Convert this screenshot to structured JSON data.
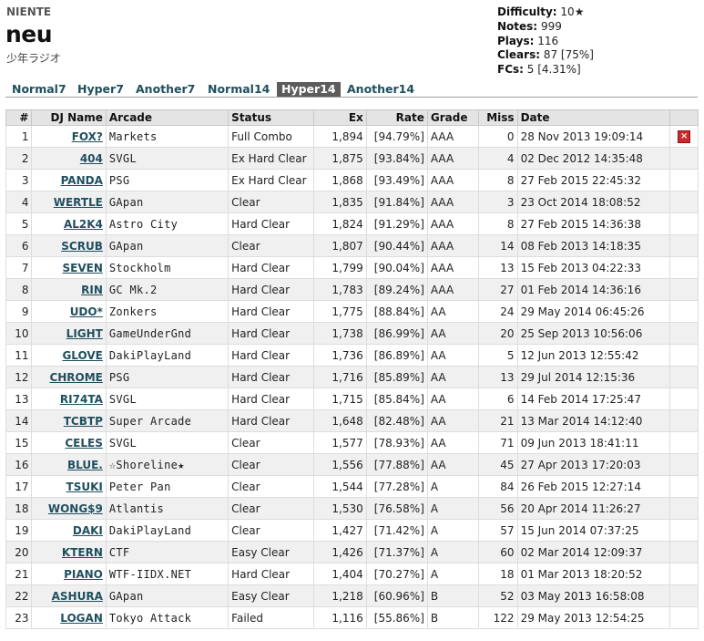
{
  "song": {
    "artist": "NIENTE",
    "title": "neu",
    "genre": "少年ラジオ"
  },
  "stats": [
    {
      "label": "Difficulty:",
      "value": "10★"
    },
    {
      "label": "Notes:",
      "value": "999"
    },
    {
      "label": "Plays:",
      "value": "116"
    },
    {
      "label": "Clears:",
      "value": "87 [75%]"
    },
    {
      "label": "FCs:",
      "value": "5 [4.31%]"
    }
  ],
  "tabs": [
    {
      "label": "Normal7"
    },
    {
      "label": "Hyper7"
    },
    {
      "label": "Another7"
    },
    {
      "label": "Normal14"
    },
    {
      "label": "Hyper14",
      "active": true
    },
    {
      "label": "Another14"
    }
  ],
  "table": {
    "headers": [
      "#",
      "DJ Name",
      "Arcade",
      "Status",
      "Ex",
      "Rate",
      "Grade",
      "Miss",
      "Date"
    ],
    "rows": [
      {
        "rank": "1",
        "dj": "FOX?",
        "arcade": "Markets",
        "status": "Full Combo",
        "ex": "1,894",
        "rate": "[94.79%]",
        "grade": "AAA",
        "miss": "0",
        "date": "28 Nov 2013 19:09:14",
        "delete": true
      },
      {
        "rank": "2",
        "dj": "404",
        "arcade": "SVGL",
        "status": "Ex Hard Clear",
        "ex": "1,875",
        "rate": "[93.84%]",
        "grade": "AAA",
        "miss": "4",
        "date": "02 Dec 2012 14:35:48"
      },
      {
        "rank": "3",
        "dj": "PANDA",
        "arcade": "PSG",
        "status": "Ex Hard Clear",
        "ex": "1,868",
        "rate": "[93.49%]",
        "grade": "AAA",
        "miss": "8",
        "date": "27 Feb 2015 22:45:32"
      },
      {
        "rank": "4",
        "dj": "WERTLE",
        "arcade": "GApan",
        "status": "Clear",
        "ex": "1,835",
        "rate": "[91.84%]",
        "grade": "AAA",
        "miss": "3",
        "date": "23 Oct 2014 18:08:52"
      },
      {
        "rank": "5",
        "dj": "AL2K4",
        "arcade": "Astro City",
        "status": "Hard Clear",
        "ex": "1,824",
        "rate": "[91.29%]",
        "grade": "AAA",
        "miss": "8",
        "date": "27 Feb 2015 14:36:38"
      },
      {
        "rank": "6",
        "dj": "SCRUB",
        "arcade": "GApan",
        "status": "Clear",
        "ex": "1,807",
        "rate": "[90.44%]",
        "grade": "AAA",
        "miss": "14",
        "date": "08 Feb 2013 14:18:35"
      },
      {
        "rank": "7",
        "dj": "SEVEN",
        "arcade": "Stockholm",
        "status": "Hard Clear",
        "ex": "1,799",
        "rate": "[90.04%]",
        "grade": "AAA",
        "miss": "13",
        "date": "15 Feb 2013 04:22:33"
      },
      {
        "rank": "8",
        "dj": "RIN",
        "arcade": "GC Mk.2",
        "status": "Hard Clear",
        "ex": "1,783",
        "rate": "[89.24%]",
        "grade": "AAA",
        "miss": "27",
        "date": "01 Feb 2014 14:36:16"
      },
      {
        "rank": "9",
        "dj": "UDO*",
        "arcade": "Zonkers",
        "status": "Hard Clear",
        "ex": "1,775",
        "rate": "[88.84%]",
        "grade": "AA",
        "miss": "24",
        "date": "29 May 2014 06:45:26"
      },
      {
        "rank": "10",
        "dj": "LIGHT",
        "arcade": "GameUnderGnd",
        "status": "Hard Clear",
        "ex": "1,738",
        "rate": "[86.99%]",
        "grade": "AA",
        "miss": "20",
        "date": "25 Sep 2013 10:56:06"
      },
      {
        "rank": "11",
        "dj": "GLOVE",
        "arcade": "DakiPlayLand",
        "status": "Hard Clear",
        "ex": "1,736",
        "rate": "[86.89%]",
        "grade": "AA",
        "miss": "5",
        "date": "12 Jun 2013 12:55:42"
      },
      {
        "rank": "12",
        "dj": "CHROME",
        "arcade": "PSG",
        "status": "Hard Clear",
        "ex": "1,716",
        "rate": "[85.89%]",
        "grade": "AA",
        "miss": "13",
        "date": "29 Jul 2014 12:15:36"
      },
      {
        "rank": "13",
        "dj": "RI74TA",
        "arcade": "SVGL",
        "status": "Hard Clear",
        "ex": "1,715",
        "rate": "[85.84%]",
        "grade": "AA",
        "miss": "6",
        "date": "14 Feb 2014 17:25:47"
      },
      {
        "rank": "14",
        "dj": "TCBTP",
        "arcade": "Super Arcade",
        "status": "Hard Clear",
        "ex": "1,648",
        "rate": "[82.48%]",
        "grade": "AA",
        "miss": "21",
        "date": "13 Mar 2014 14:12:40"
      },
      {
        "rank": "15",
        "dj": "CELES",
        "arcade": "SVGL",
        "status": "Clear",
        "ex": "1,577",
        "rate": "[78.93%]",
        "grade": "AA",
        "miss": "71",
        "date": "09 Jun 2013 18:41:11"
      },
      {
        "rank": "16",
        "dj": "BLUE.",
        "arcade": "☆Shoreline★",
        "status": "Clear",
        "ex": "1,556",
        "rate": "[77.88%]",
        "grade": "AA",
        "miss": "45",
        "date": "27 Apr 2013 17:20:03"
      },
      {
        "rank": "17",
        "dj": "TSUKI",
        "arcade": "Peter Pan",
        "status": "Clear",
        "ex": "1,544",
        "rate": "[77.28%]",
        "grade": "A",
        "miss": "84",
        "date": "26 Feb 2015 12:27:14"
      },
      {
        "rank": "18",
        "dj": "WONG$9",
        "arcade": "Atlantis",
        "status": "Clear",
        "ex": "1,530",
        "rate": "[76.58%]",
        "grade": "A",
        "miss": "56",
        "date": "20 Apr 2014 11:26:27"
      },
      {
        "rank": "19",
        "dj": "DAKI",
        "arcade": "DakiPlayLand",
        "status": "Clear",
        "ex": "1,427",
        "rate": "[71.42%]",
        "grade": "A",
        "miss": "57",
        "date": "15 Jun 2014 07:37:25"
      },
      {
        "rank": "20",
        "dj": "KTERN",
        "arcade": "CTF",
        "status": "Easy Clear",
        "ex": "1,426",
        "rate": "[71.37%]",
        "grade": "A",
        "miss": "60",
        "date": "02 Mar 2014 12:09:37"
      },
      {
        "rank": "21",
        "dj": "PIANO",
        "arcade": "WTF-IIDX.NET",
        "status": "Hard Clear",
        "ex": "1,404",
        "rate": "[70.27%]",
        "grade": "A",
        "miss": "18",
        "date": "01 Mar 2013 18:20:52"
      },
      {
        "rank": "22",
        "dj": "ASHURA",
        "arcade": "GApan",
        "status": "Easy Clear",
        "ex": "1,218",
        "rate": "[60.96%]",
        "grade": "B",
        "miss": "52",
        "date": "03 May 2013 16:58:08"
      },
      {
        "rank": "23",
        "dj": "LOGAN",
        "arcade": "Tokyo Attack",
        "status": "Failed",
        "ex": "1,116",
        "rate": "[55.86%]",
        "grade": "B",
        "miss": "122",
        "date": "29 May 2013 12:54:25"
      }
    ]
  },
  "icons": {
    "delete": "delete-icon",
    "delete_color": "#cc2a2a",
    "link_color": "#1f4f5f",
    "active_tab_color": "#5c5c5c"
  }
}
